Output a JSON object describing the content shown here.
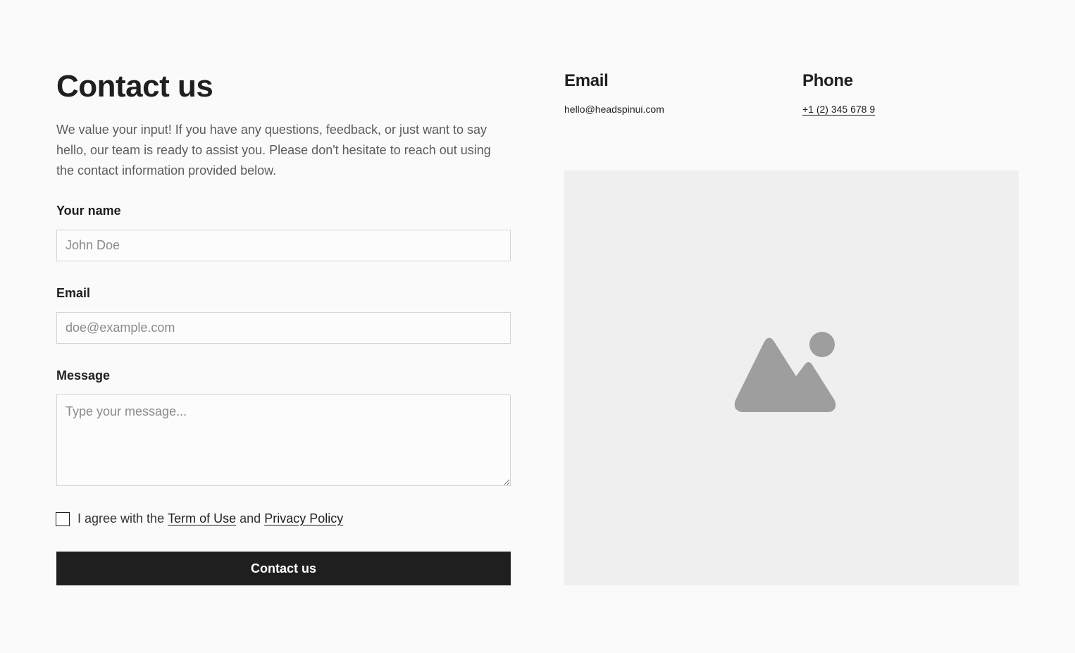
{
  "contact": {
    "title": "Contact us",
    "intro": "We value your input! If you have any questions, feedback, or just want to say hello, our team is ready to assist you. Please don't hesitate to reach out using the contact information provided below."
  },
  "form": {
    "name_label": "Your name",
    "name_placeholder": "John Doe",
    "email_label": "Email",
    "email_placeholder": "doe@example.com",
    "message_label": "Message",
    "message_placeholder": "Type your message...",
    "agree_prefix": "I agree with the",
    "terms_link": "Term of Use",
    "agree_and": "and",
    "privacy_link": "Privacy Policy",
    "submit_label": "Contact us"
  },
  "info": {
    "email_heading": "Email",
    "email_value": "hello@headspinui.com",
    "phone_heading": "Phone",
    "phone_value": "+1 (2) 345 678 9"
  },
  "image": {
    "icon": "image-placeholder-icon"
  },
  "colors": {
    "background": "#fafafa",
    "button": "#1f1f1f",
    "image_bg": "#efefef",
    "icon": "#9e9e9e"
  }
}
